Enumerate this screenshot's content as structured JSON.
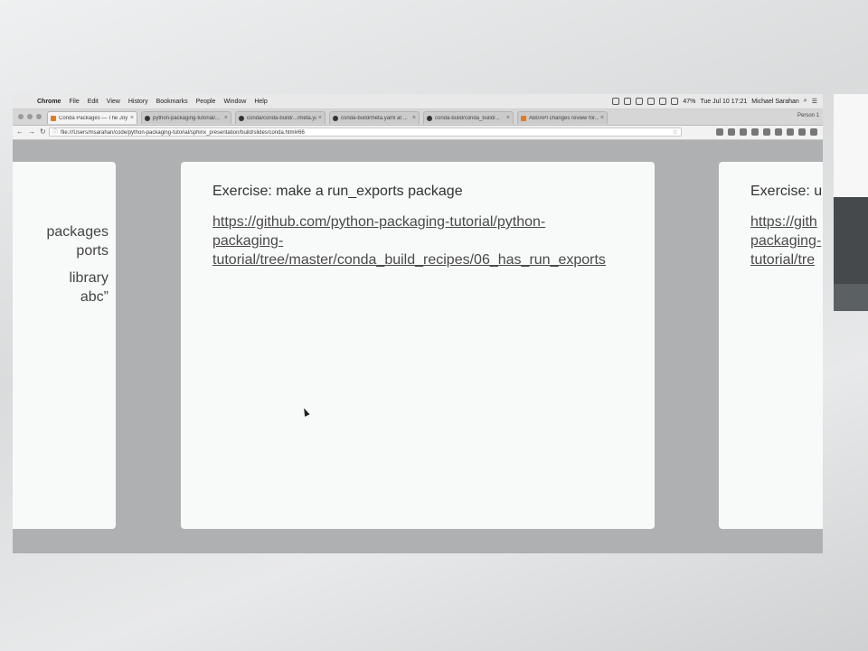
{
  "menubar": {
    "items": [
      "Chrome",
      "File",
      "Edit",
      "View",
      "History",
      "Bookmarks",
      "People",
      "Window",
      "Help"
    ],
    "battery": "47%",
    "clock": "Tue Jul 10  17:21",
    "user": "Michael Sarahan"
  },
  "tabs": [
    {
      "label": "Conda Packages — The Joy of...",
      "active": true,
      "favicon": "document-icon"
    },
    {
      "label": "python-packaging-tutorial/...",
      "active": false,
      "favicon": "github-icon"
    },
    {
      "label": "conda/conda-build/.../meta.yaml",
      "active": false,
      "favicon": "github-icon"
    },
    {
      "label": "conda-build/meta.yaml at ...",
      "active": false,
      "favicon": "github-icon"
    },
    {
      "label": "conda-build/conda_build/...",
      "active": false,
      "favicon": "github-icon"
    },
    {
      "label": "ABI/API changes review for...",
      "active": false,
      "favicon": "abi-icon"
    }
  ],
  "profile": "Person 1",
  "address": {
    "url": "file:///Users/msarahan/code/python-packaging-tutorial/sphinx_presentation/build/slides/conda.html#66"
  },
  "slides": {
    "left": {
      "lines": [
        "packages",
        "ports",
        "library",
        "abc”"
      ]
    },
    "center": {
      "title": "Exercise: make a run_exports package",
      "link_lines": [
        "https://github.com/python-packaging-tutorial/python-",
        "packaging-",
        "tutorial/tree/master/conda_build_recipes/06_has_run_exports"
      ]
    },
    "right": {
      "title": "Exercise: u",
      "link_lines": [
        "https://gith",
        "packaging-",
        "tutorial/tre"
      ]
    }
  }
}
